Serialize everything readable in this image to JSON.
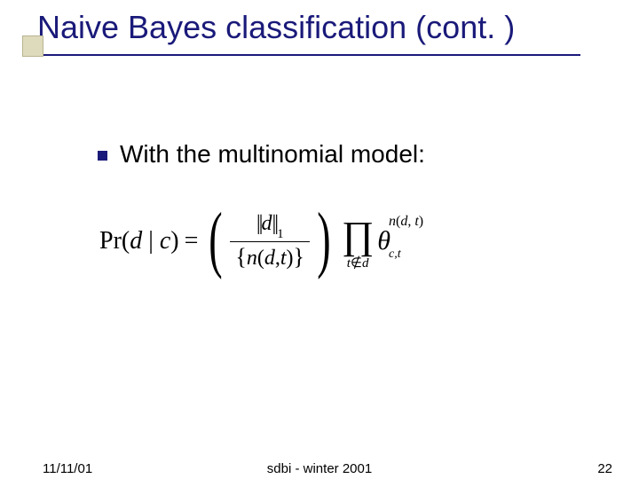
{
  "title": "Naive Bayes classification (cont. )",
  "bullet": {
    "text": "With the multinomial model:"
  },
  "equation": {
    "pr_label": "Pr",
    "args_open": "(",
    "arg_d": "d",
    "bar": " | ",
    "arg_c": "c",
    "args_close": ")",
    "equals": "=",
    "num_bars_l": "||",
    "num_d": "d",
    "num_bars_r": "||",
    "num_sub": "1",
    "den_open": "{",
    "den_n": "n",
    "den_paren_l": "(",
    "den_d": "d",
    "den_comma": ",",
    "den_t": "t",
    "den_paren_r": ")",
    "den_close": "}",
    "prod_sym": "∏",
    "prod_sub_t": "t",
    "prod_sub_notin": "∉",
    "prod_sub_d": "d",
    "theta": "θ",
    "theta_sub": "c,t",
    "theta_sup_n": "n",
    "theta_sup_paren_l": "(",
    "theta_sup_d": "d",
    "theta_sup_comma": ", ",
    "theta_sup_t": "t",
    "theta_sup_paren_r": ")"
  },
  "footer": {
    "date": "11/11/01",
    "center": "sdbi - winter 2001",
    "page": "22"
  }
}
